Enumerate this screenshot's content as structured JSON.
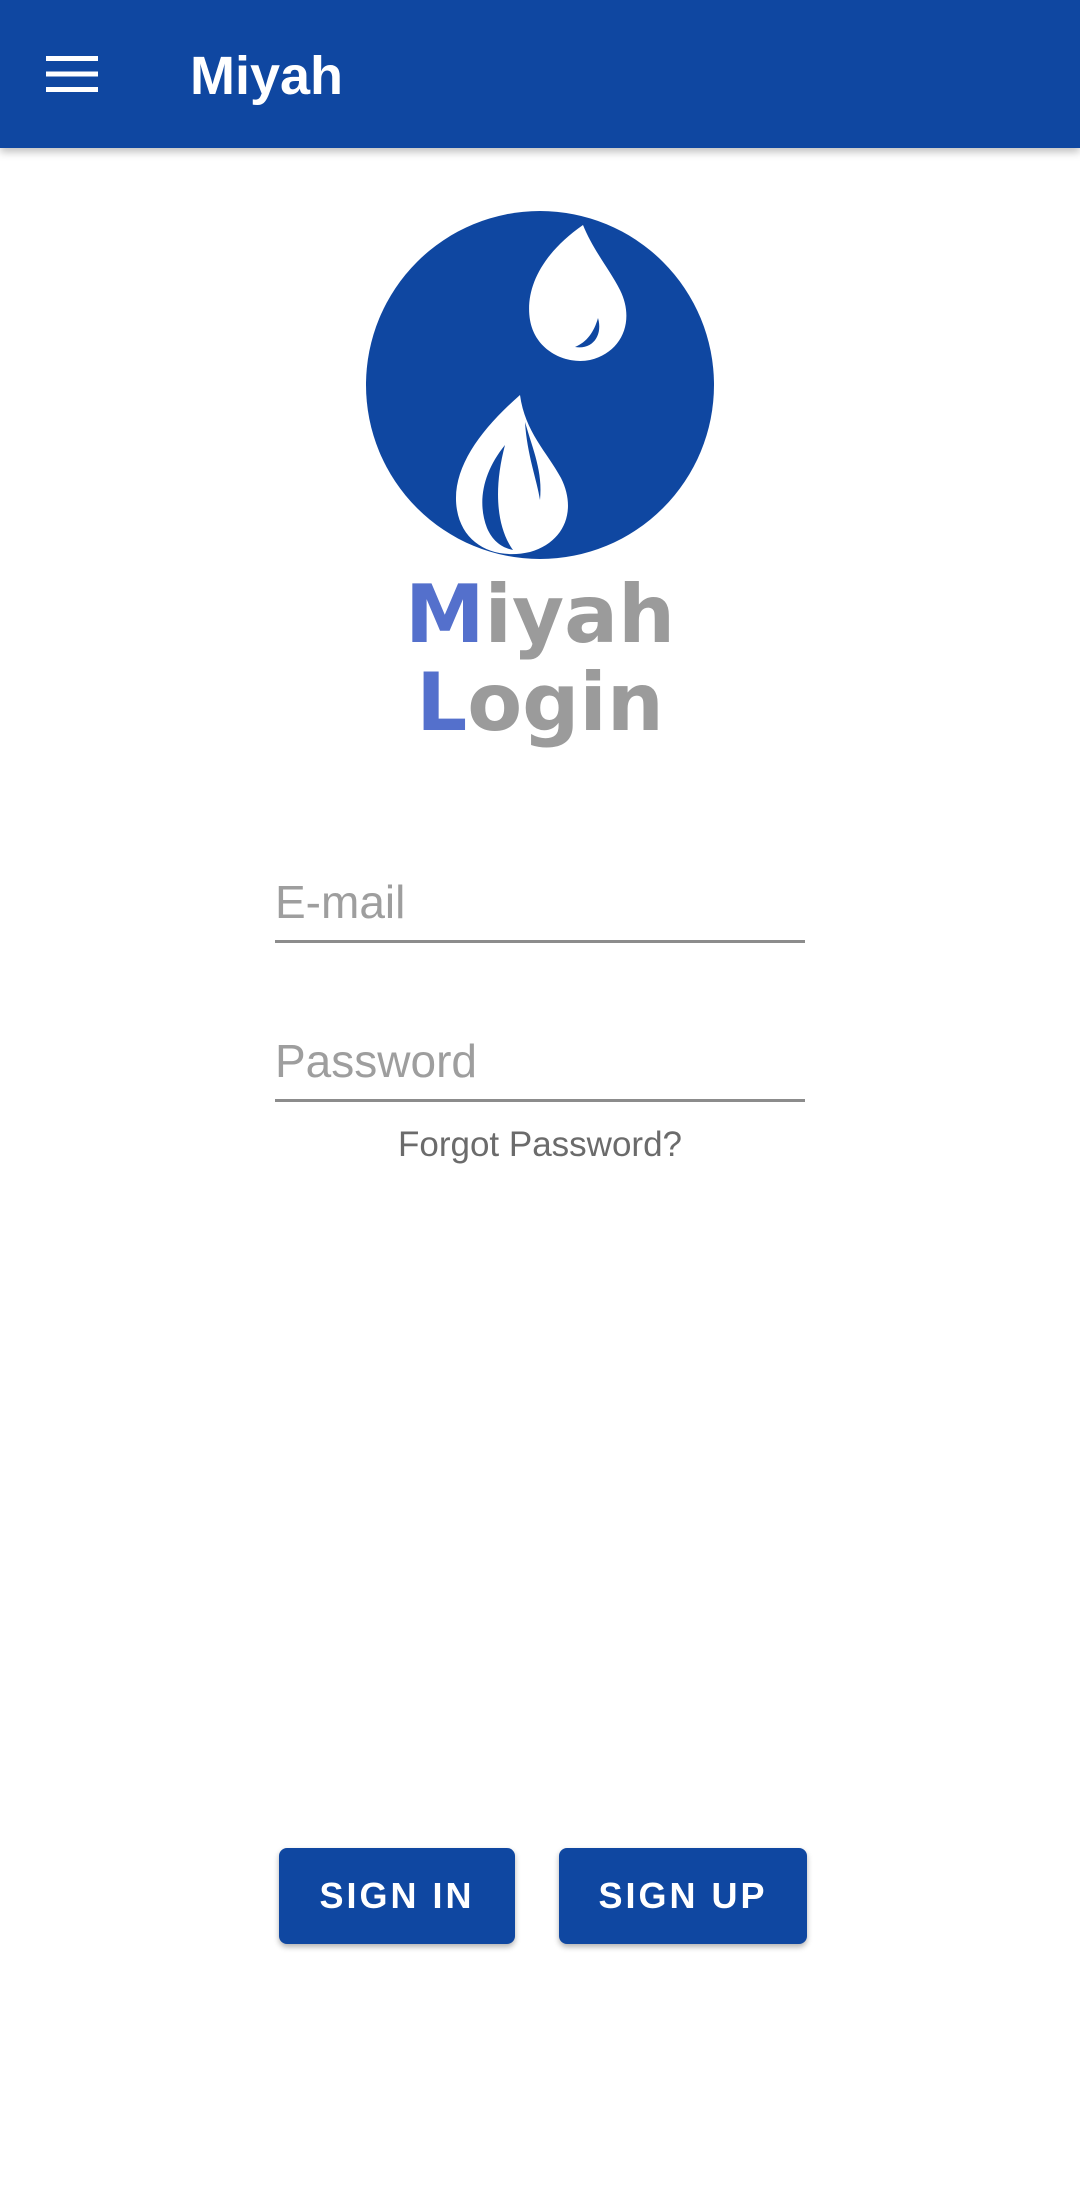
{
  "app_bar": {
    "title": "Miyah",
    "menu_icon": "hamburger-menu-icon",
    "background_color": "#0f47a1"
  },
  "logo": {
    "icon": "water-drops-logo-icon",
    "circle_color": "#0f47a1"
  },
  "brand": {
    "line1_accent": "M",
    "line1_rest": "iyah",
    "line2_accent": "L",
    "line2_rest": "ogin",
    "accent_color": "#5470cc",
    "text_color": "#9b9b9b"
  },
  "form": {
    "email_placeholder": "E-mail",
    "email_value": "",
    "password_placeholder": "Password",
    "password_value": "",
    "forgot_password_label": "Forgot Password?"
  },
  "actions": {
    "sign_in_label": "SIGN IN",
    "sign_up_label": "SIGN UP",
    "button_color": "#0f47a1"
  }
}
